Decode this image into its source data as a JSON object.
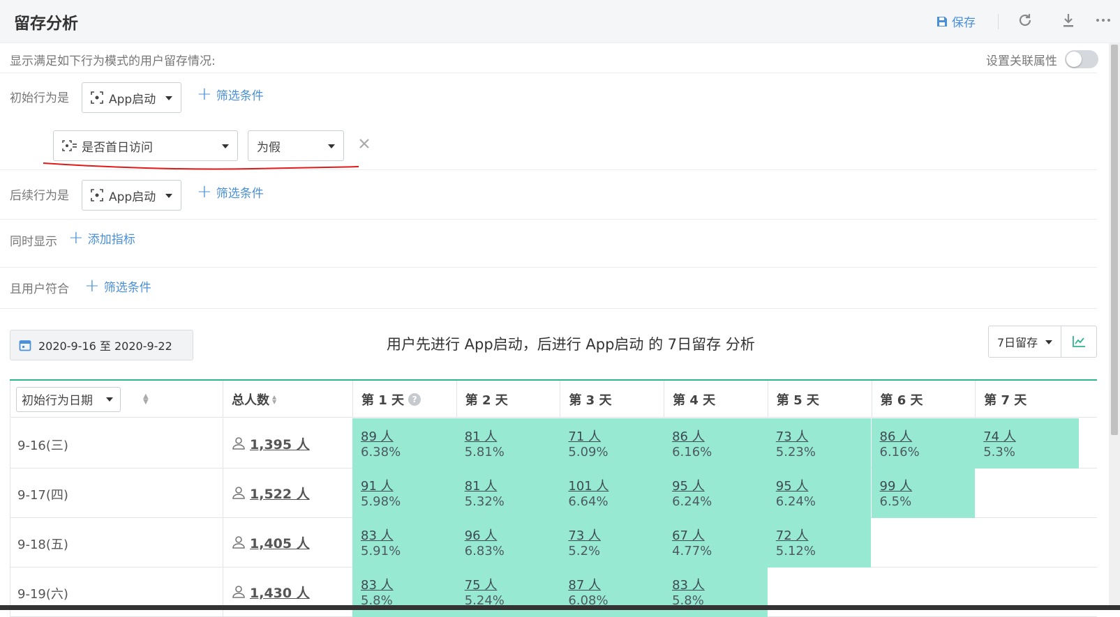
{
  "header": {
    "title": "留存分析",
    "save_label": "保存"
  },
  "condition": {
    "description": "显示满足如下行为模式的用户留存情况:",
    "link_attr_label": "设置关联属性"
  },
  "initial": {
    "label": "初始行为是",
    "event": "App启动",
    "filter_link": "筛选条件",
    "filter": {
      "property": "是否首日访问",
      "operator": "为假"
    }
  },
  "following": {
    "label": "后续行为是",
    "event": "App启动",
    "filter_link": "筛选条件"
  },
  "also_show": {
    "label": "同时显示",
    "link": "添加指标"
  },
  "user_match": {
    "label": "且用户符合",
    "link": "筛选条件"
  },
  "toolbar": {
    "date_range": "2020-9-16 至 2020-9-22",
    "analysis_title": "用户先进行 App启动，后进行 App启动 的 7日留存 分析",
    "period": "7日留存"
  },
  "table": {
    "date_col": "初始行为日期",
    "total_col": "总人数",
    "days": [
      "第 1 天",
      "第 2 天",
      "第 3 天",
      "第 4 天",
      "第 5 天",
      "第 6 天",
      "第 7 天"
    ],
    "rows": [
      {
        "date": "9-16(三)",
        "total": "1,395 人",
        "cells": [
          {
            "count": "89 人",
            "pct": "6.38%"
          },
          {
            "count": "81 人",
            "pct": "5.81%"
          },
          {
            "count": "71 人",
            "pct": "5.09%"
          },
          {
            "count": "86 人",
            "pct": "6.16%"
          },
          {
            "count": "73 人",
            "pct": "5.23%"
          },
          {
            "count": "86 人",
            "pct": "6.16%"
          },
          {
            "count": "74 人",
            "pct": "5.3%"
          }
        ]
      },
      {
        "date": "9-17(四)",
        "total": "1,522 人",
        "cells": [
          {
            "count": "91 人",
            "pct": "5.98%"
          },
          {
            "count": "81 人",
            "pct": "5.32%"
          },
          {
            "count": "101 人",
            "pct": "6.64%"
          },
          {
            "count": "95 人",
            "pct": "6.24%"
          },
          {
            "count": "95 人",
            "pct": "6.24%"
          },
          {
            "count": "99 人",
            "pct": "6.5%"
          }
        ]
      },
      {
        "date": "9-18(五)",
        "total": "1,405 人",
        "cells": [
          {
            "count": "83 人",
            "pct": "5.91%"
          },
          {
            "count": "96 人",
            "pct": "6.83%"
          },
          {
            "count": "73 人",
            "pct": "5.2%"
          },
          {
            "count": "67 人",
            "pct": "4.77%"
          },
          {
            "count": "72 人",
            "pct": "5.12%"
          }
        ]
      },
      {
        "date": "9-19(六)",
        "total": "1,430 人",
        "cells": [
          {
            "count": "83 人",
            "pct": "5.8%"
          },
          {
            "count": "75 人",
            "pct": "5.24%"
          },
          {
            "count": "87 人",
            "pct": "6.08%"
          },
          {
            "count": "83 人",
            "pct": "5.8%"
          }
        ]
      }
    ]
  },
  "colors": {
    "accent": "#4a90d9",
    "cell_fill": "#97ead1",
    "table_top": "#2fb58c"
  }
}
